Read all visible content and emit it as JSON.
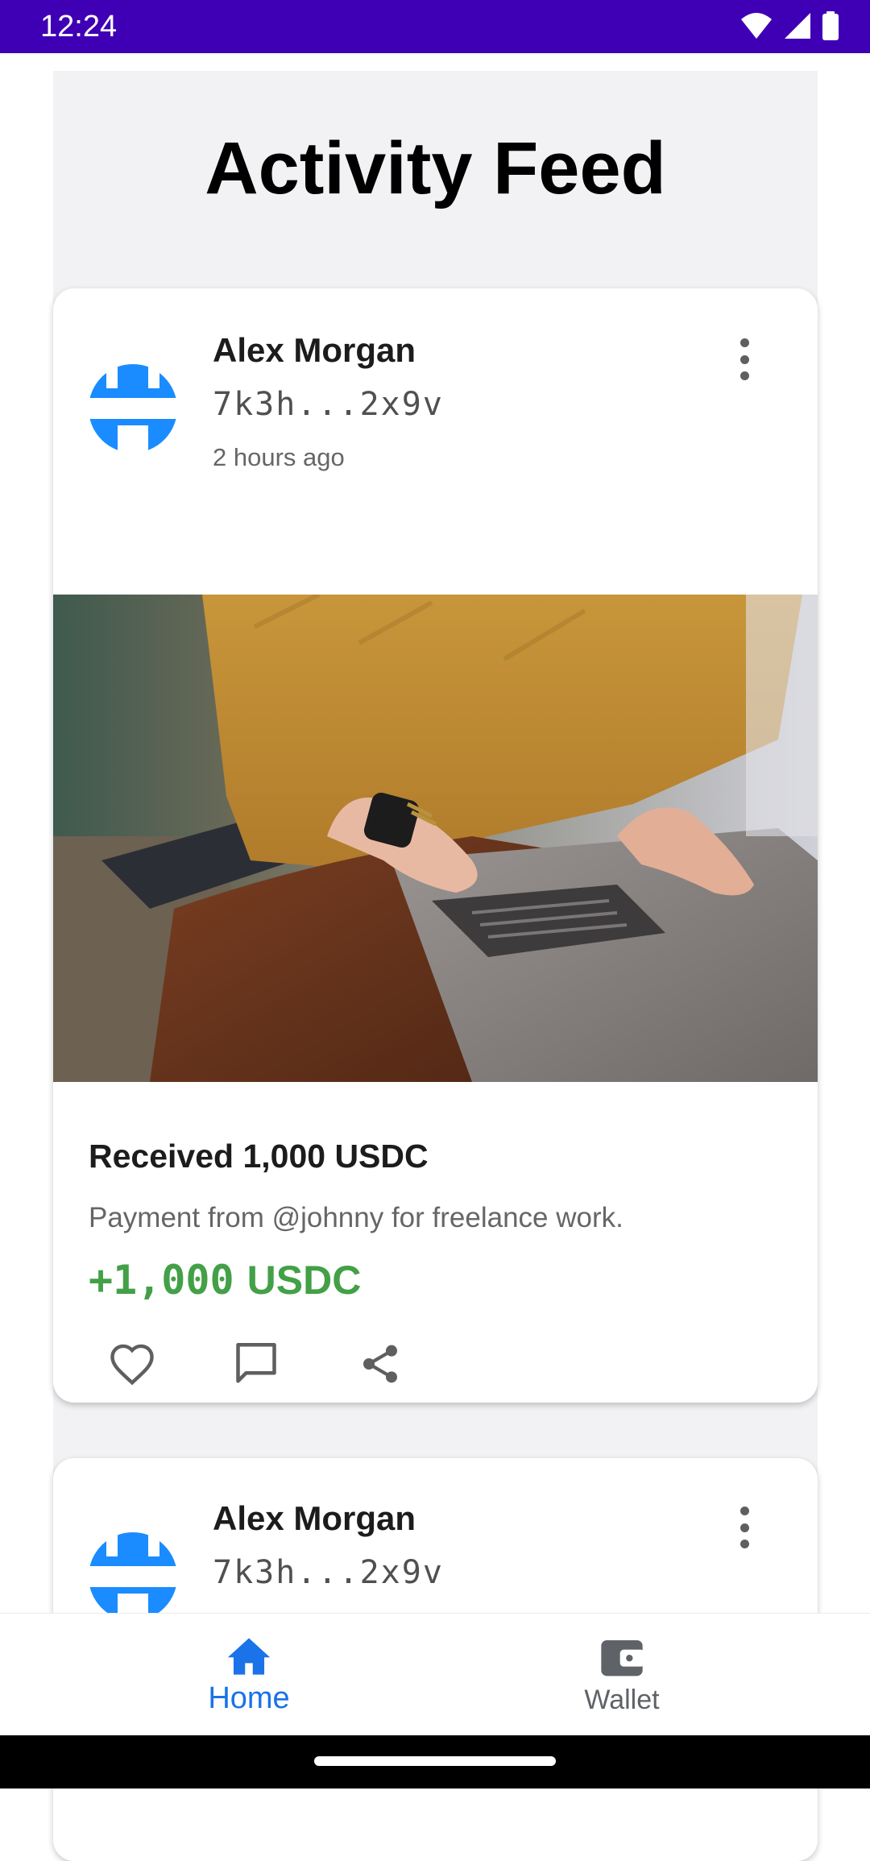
{
  "status_bar": {
    "time": "12:24",
    "icons": [
      "wifi-icon",
      "cellular-signal-icon",
      "battery-icon"
    ]
  },
  "page": {
    "title": "Activity Feed"
  },
  "colors": {
    "status_bar": "#3f00b5",
    "feed_background": "#f2f2f4",
    "avatar_blue": "#1a8cff",
    "amount_green": "#43a047",
    "nav_active": "#1a73e8",
    "nav_inactive": "#5f6368"
  },
  "feed": {
    "posts": [
      {
        "user_name": "Alex Morgan",
        "wallet_address": "7k3h...2x9v",
        "time_ago": "2 hours ago",
        "image": "photo of person in mustard sweater typing on laptop",
        "title": "Received 1,000 USDC",
        "description": "Payment from @johnny for freelance work.",
        "amount": "+1,000",
        "amount_unit": "USDC",
        "actions": [
          "heart-icon",
          "comment-icon",
          "share-icon"
        ]
      },
      {
        "user_name": "Alex Morgan",
        "wallet_address": "7k3h...2x9v"
      }
    ]
  },
  "bottom_nav": {
    "items": [
      {
        "label": "Home",
        "icon": "home-icon",
        "active": true
      },
      {
        "label": "Wallet",
        "icon": "wallet-icon",
        "active": false
      }
    ]
  }
}
